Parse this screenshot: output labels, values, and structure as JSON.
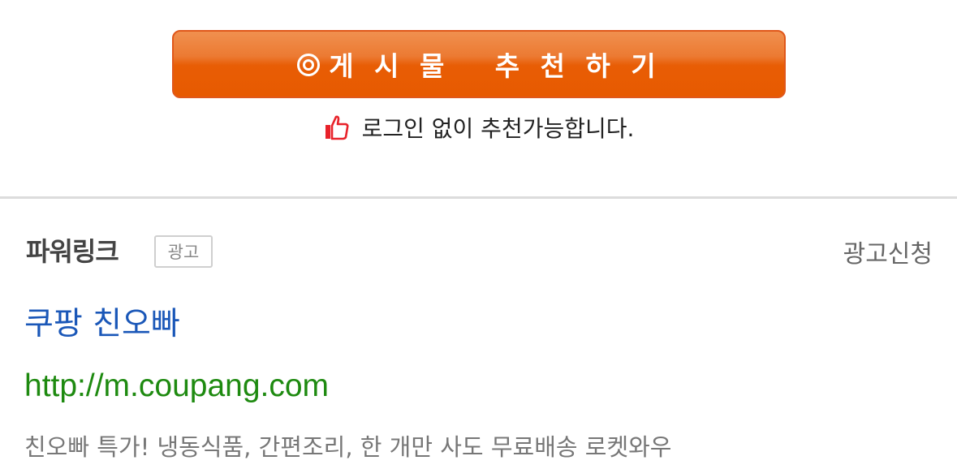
{
  "recommend": {
    "button_label": "게 시 물   추 천 하 기",
    "note": "로그인 없이 추천가능합니다."
  },
  "powerlink": {
    "title": "파워링크",
    "badge": "광고",
    "apply_label": "광고신청",
    "ad": {
      "title": "쿠팡 친오빠",
      "url": "http://m.coupang.com",
      "description": "친오빠 특가! 냉동식품, 간편조리, 한 개만 사도 무료배송 로켓와우"
    }
  },
  "icons": {
    "button_icon": "target-circle-icon",
    "note_icon": "thumbs-up-icon"
  },
  "colors": {
    "button_orange": "#e75a00",
    "link_blue": "#1a57b8",
    "url_green": "#1e8a10",
    "thumb_red": "#e8222a"
  }
}
